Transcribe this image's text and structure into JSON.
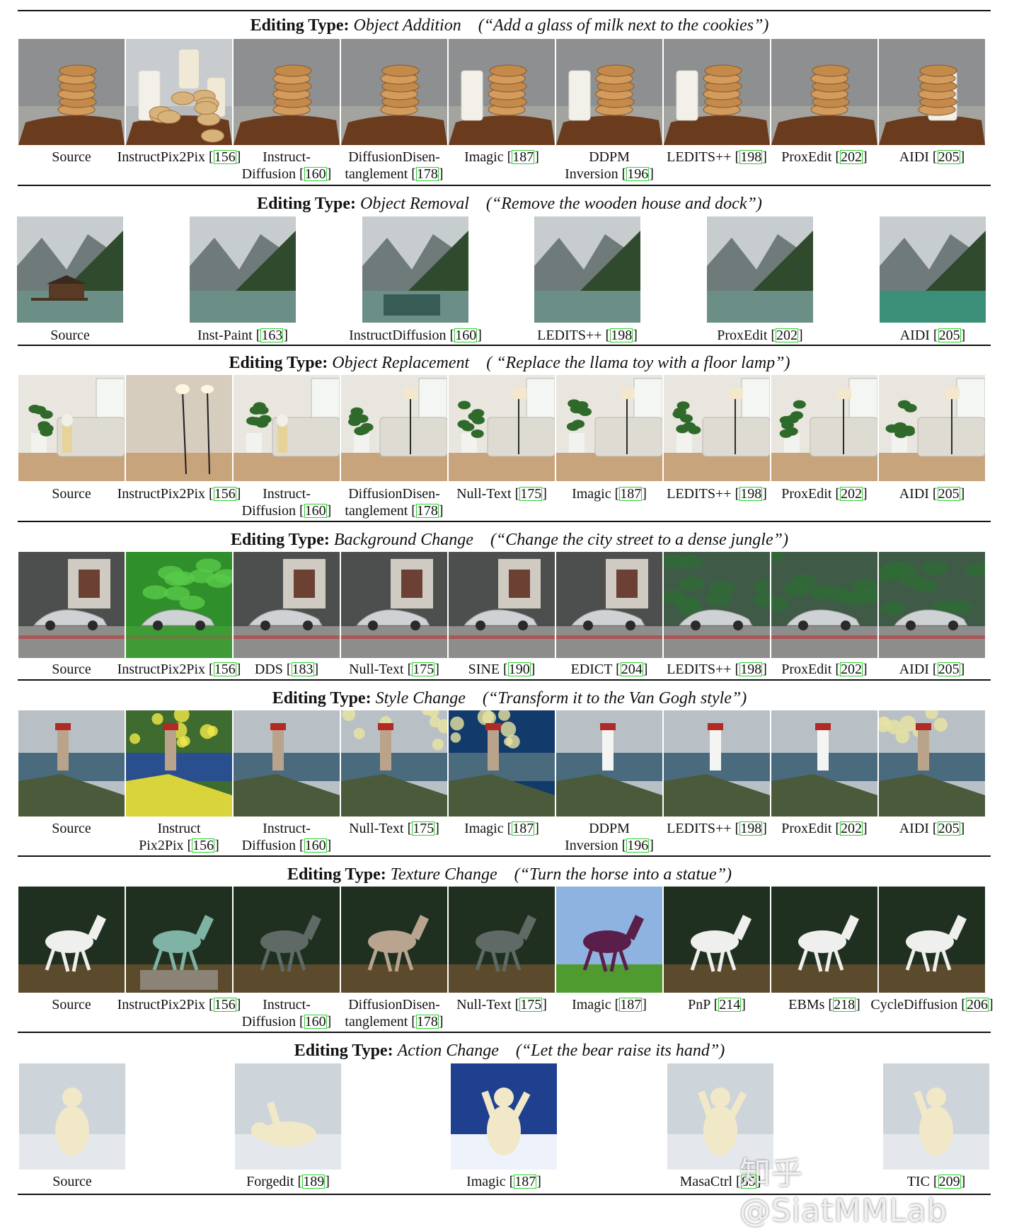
{
  "label_prefix": "Editing Type:",
  "watermark_text": "知乎 @SiatMMLab",
  "sections": [
    {
      "type": "Object Addition",
      "prompt": "(“Add a glass of milk next to the cookies”)",
      "theme": "cookies",
      "captions": [
        {
          "l1": "Source"
        },
        {
          "l1": "InstructPix2Pix [",
          "ref": "156",
          "after": "]"
        },
        {
          "l1": "Instruct-",
          "l2": "Diffusion [",
          "ref": "160",
          "after": "]"
        },
        {
          "l1": "DiffusionDisen-",
          "l2": "tanglement [",
          "ref": "178",
          "after": "]"
        },
        {
          "l1": "Imagic [",
          "ref": "187",
          "after": "]"
        },
        {
          "l1": "DDPM",
          "l2": "Inversion [",
          "ref": "196",
          "after": "]"
        },
        {
          "l1": "LEDITS++ [",
          "ref": "198",
          "after": "]"
        },
        {
          "l1": "ProxEdit [",
          "ref": "202",
          "after": "]"
        },
        {
          "l1": "AIDI [",
          "ref": "205",
          "after": "]"
        }
      ]
    },
    {
      "type": "Object Removal",
      "prompt": "(“Remove the wooden house and dock”)",
      "theme": "lake",
      "captions": [
        {
          "l1": "Source"
        },
        {
          "l1": "Inst-Paint [",
          "ref": "163",
          "after": "]"
        },
        {
          "l1": "InstructDiffusion [",
          "ref": "160",
          "after": "]"
        },
        {
          "l1": "LEDITS++ [",
          "ref": "198",
          "after": "]"
        },
        {
          "l1": "ProxEdit [",
          "ref": "202",
          "after": "]"
        },
        {
          "l1": "AIDI [",
          "ref": "205",
          "after": "]"
        }
      ]
    },
    {
      "type": "Object Replacement",
      "prompt": "( “Replace the llama toy with a floor lamp”)",
      "theme": "room",
      "captions": [
        {
          "l1": "Source"
        },
        {
          "l1": "InstructPix2Pix [",
          "ref": "156",
          "after": "]"
        },
        {
          "l1": "Instruct-",
          "l2": "Diffusion [",
          "ref": "160",
          "after": "]"
        },
        {
          "l1": "DiffusionDisen-",
          "l2": "tanglement [",
          "ref": "178",
          "after": "]"
        },
        {
          "l1": "Null-Text [",
          "ref": "175",
          "after": "]"
        },
        {
          "l1": "Imagic [",
          "ref": "187",
          "after": "]"
        },
        {
          "l1": "LEDITS++ [",
          "ref": "198",
          "after": "]"
        },
        {
          "l1": "ProxEdit [",
          "ref": "202",
          "after": "]"
        },
        {
          "l1": "AIDI [",
          "ref": "205",
          "after": "]"
        }
      ]
    },
    {
      "type": "Background Change",
      "prompt": "(“Change the city street to a dense jungle”)",
      "theme": "car",
      "captions": [
        {
          "l1": "Source"
        },
        {
          "l1": "InstructPix2Pix [",
          "ref": "156",
          "after": "]"
        },
        {
          "l1": "DDS [",
          "ref": "183",
          "after": "]"
        },
        {
          "l1": "Null-Text [",
          "ref": "175",
          "after": "]"
        },
        {
          "l1": "SINE [",
          "ref": "190",
          "after": "]"
        },
        {
          "l1": "EDICT [",
          "ref": "204",
          "after": "]"
        },
        {
          "l1": "LEDITS++ [",
          "ref": "198",
          "after": "]"
        },
        {
          "l1": "ProxEdit [",
          "ref": "202",
          "after": "]"
        },
        {
          "l1": "AIDI [",
          "ref": "205",
          "after": "]"
        }
      ]
    },
    {
      "type": "Style Change",
      "prompt": "(“Transform it to the Van Gogh style”)",
      "theme": "lighthouse",
      "captions": [
        {
          "l1": "Source"
        },
        {
          "l1": "Instruct",
          "l2": "Pix2Pix [",
          "ref": "156",
          "after": "]"
        },
        {
          "l1": "Instruct-",
          "l2": "Diffusion [",
          "ref": "160",
          "after": "]"
        },
        {
          "l1": "Null-Text [",
          "ref": "175",
          "after": "]"
        },
        {
          "l1": "Imagic [",
          "ref": "187",
          "after": "]"
        },
        {
          "l1": "DDPM",
          "l2": "Inversion [",
          "ref": "196",
          "after": "]"
        },
        {
          "l1": "LEDITS++ [",
          "ref": "198",
          "after": "]"
        },
        {
          "l1": "ProxEdit [",
          "ref": "202",
          "after": "]"
        },
        {
          "l1": "AIDI [",
          "ref": "205",
          "after": "]"
        }
      ]
    },
    {
      "type": "Texture Change",
      "prompt": "(“Turn the horse into a statue”)",
      "theme": "horse",
      "captions": [
        {
          "l1": "Source"
        },
        {
          "l1": "InstructPix2Pix [",
          "ref": "156",
          "after": "]"
        },
        {
          "l1": "Instruct-",
          "l2": "Diffusion [",
          "ref": "160",
          "after": "]"
        },
        {
          "l1": "DiffusionDisen-",
          "l2": "tanglement [",
          "ref": "178",
          "after": "]"
        },
        {
          "l1": "Null-Text [",
          "ref": "175",
          "after": "]"
        },
        {
          "l1": "Imagic [",
          "ref": "187",
          "after": "]"
        },
        {
          "l1": "PnP [",
          "ref": "214",
          "after": "]"
        },
        {
          "l1": "EBMs [",
          "ref": "218",
          "after": "]"
        },
        {
          "l1": "CycleDiffusion [",
          "ref": "206",
          "after": "]"
        }
      ]
    },
    {
      "type": "Action Change",
      "prompt": "(“Let the bear raise its hand”)",
      "theme": "bear",
      "captions": [
        {
          "l1": "Source"
        },
        {
          "l1": "Forgedit [",
          "ref": "189",
          "after": "]"
        },
        {
          "l1": "Imagic [",
          "ref": "187",
          "after": "]"
        },
        {
          "l1": "MasaCtrl [",
          "ref": "85",
          "after": "]"
        },
        {
          "l1": "TIC [",
          "ref": "209",
          "after": "]"
        }
      ]
    }
  ]
}
